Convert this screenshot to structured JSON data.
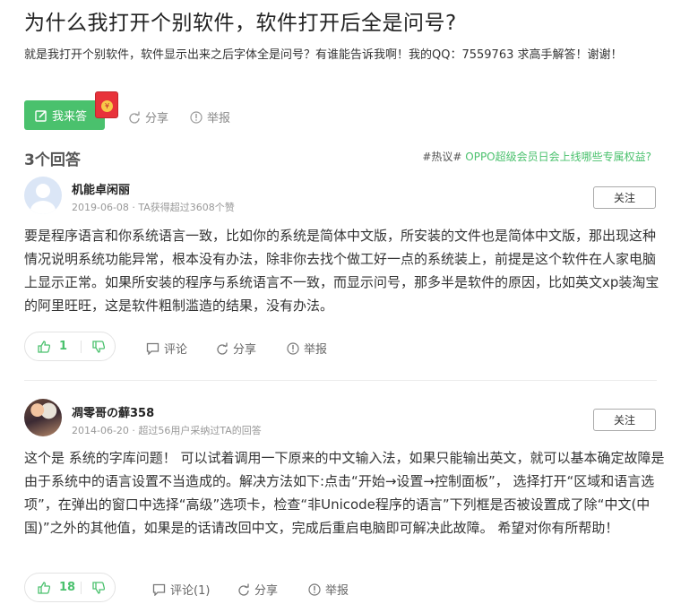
{
  "question": {
    "title": "为什么我打开个别软件，软件打开后全是问号?",
    "description": "就是我打开个别软件，软件显示出来之后字体全是问号？有谁能告诉我啊！我的QQ：7559763 求高手解答！谢谢！",
    "answer_button": "我来答",
    "share_label": "分享",
    "report_label": "举报"
  },
  "answers_header": {
    "count_label": "3个回答",
    "promo_tag": "#热议#",
    "promo_link": "OPPO超级会员日会上线哪些专属权益?"
  },
  "answers": [
    {
      "username": "机能卓闲丽",
      "meta": "2019-06-08 · TA获得超过3608个赞",
      "follow_label": "关注",
      "text": "要是程序语言和你系统语言一致，比如你的系统是简体中文版，所安装的文件也是简体中文版，那出现这种情况说明系统功能异常，根本没有办法，除非你去找个做工好一点的系统装上，前提是这个软件在人家电脑上显示正常。如果所安装的程序与系统语言不一致，而显示问号，那多半是软件的原因，比如英文xp装淘宝的阿里旺旺，这是软件粗制滥造的结果，没有办法。",
      "likes": "1",
      "comment_label": "评论",
      "share_label": "分享",
      "report_label": "举报"
    },
    {
      "username": "凋零哥の蘚358",
      "meta": "2014-06-20 · 超过56用户采纳过TA的回答",
      "follow_label": "关注",
      "text": "这个是 系统的字库问题！ 可以试着调用一下原来的中文输入法，如果只能输出英文，就可以基本确定故障是由于系统中的语言设置不当造成的。解决方法如下:点击“开始→设置→控制面板”， 选择打开“区域和语言选项”，在弹出的窗口中选择“高级”选项卡，检查“非Unicode程序的语言”下列框是否被设置成了除“中文(中国)”之外的其他值，如果是的话请改回中文，完成后重启电脑即可解决此故障。 希望对你有所帮助！",
      "likes": "18",
      "comment_label": "评论(1)",
      "share_label": "分享",
      "report_label": "举报"
    }
  ],
  "colors": {
    "accent": "#4ac16d",
    "redpack": "#e8323a"
  },
  "icons": [
    "edit-icon",
    "red-packet-icon",
    "share-icon",
    "report-icon",
    "thumb-up-icon",
    "thumb-down-icon",
    "comment-icon",
    "user-avatar"
  ]
}
